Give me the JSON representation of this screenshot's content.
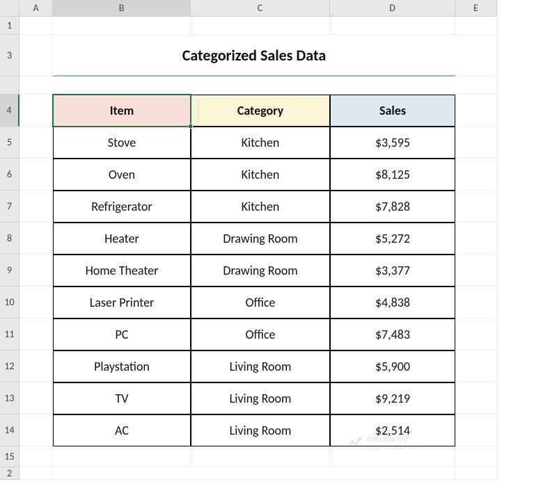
{
  "columns": [
    "A",
    "B",
    "C",
    "D",
    "E"
  ],
  "rows": [
    "1",
    "2",
    "3",
    "4",
    "5",
    "6",
    "7",
    "8",
    "9",
    "10",
    "11",
    "12",
    "13",
    "14",
    "15"
  ],
  "title": "Categorized Sales Data",
  "selected_cell": "B4",
  "headers": {
    "item": "Item",
    "category": "Category",
    "sales": "Sales"
  },
  "data": [
    {
      "item": "Stove",
      "category": "Kitchen",
      "sales": "$3,595"
    },
    {
      "item": "Oven",
      "category": "Kitchen",
      "sales": "$8,125"
    },
    {
      "item": "Refrigerator",
      "category": "Kitchen",
      "sales": "$7,828"
    },
    {
      "item": "Heater",
      "category": "Drawing Room",
      "sales": "$5,272"
    },
    {
      "item": "Home Theater",
      "category": "Drawing Room",
      "sales": "$3,377"
    },
    {
      "item": "Laser Printer",
      "category": "Office",
      "sales": "$4,838"
    },
    {
      "item": "PC",
      "category": "Office",
      "sales": "$7,483"
    },
    {
      "item": "Playstation",
      "category": "Living Room",
      "sales": "$5,900"
    },
    {
      "item": "TV",
      "category": "Living Room",
      "sales": "$9,219"
    },
    {
      "item": "AC",
      "category": "Living Room",
      "sales": "$2,514"
    }
  ],
  "watermark": {
    "name": "exceldemy",
    "tagline": "EXCEL · DATA · BI"
  },
  "colors": {
    "selection_border": "#217346",
    "title_underline": "#8eb7d8",
    "header_item_bg": "#f8e0d9",
    "header_category_bg": "#fdf3d6",
    "header_sales_bg": "#dce8f2"
  }
}
